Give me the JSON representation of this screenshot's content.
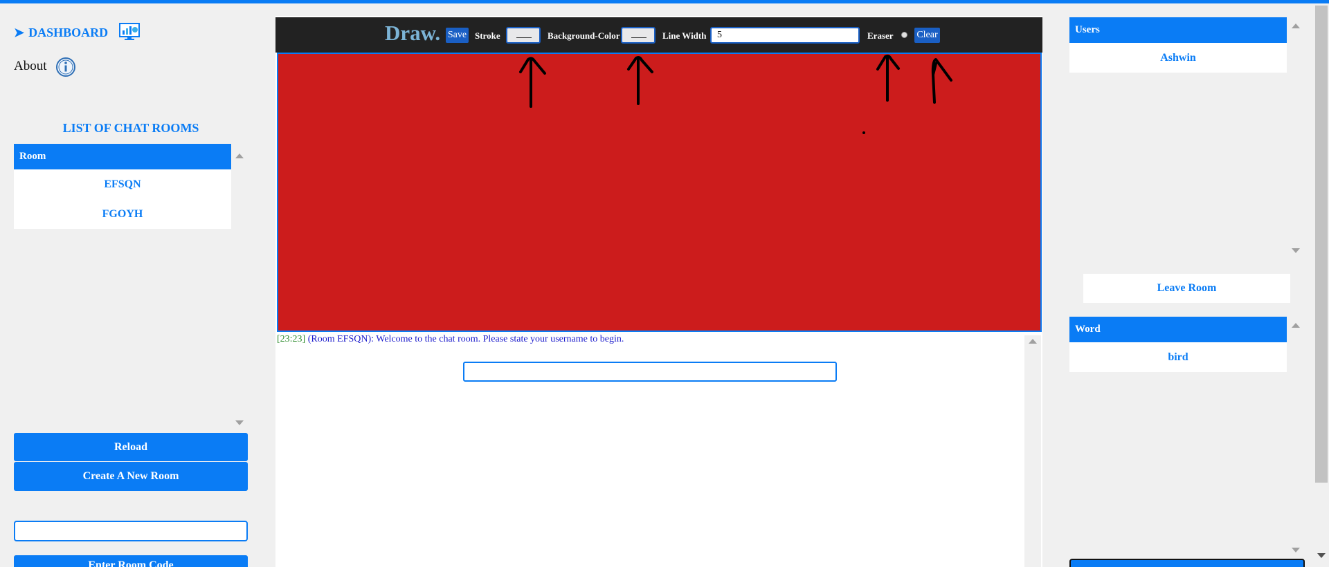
{
  "sidebar": {
    "dashboard_label": "DASHBOARD",
    "about_label": "About",
    "list_title": "LIST OF CHAT ROOMS",
    "rooms_header": "Room",
    "rooms": [
      "EFSQN",
      "FGOYH"
    ],
    "reload_label": "Reload",
    "create_label": "Create A New Room",
    "enter_label": "Enter Room Code"
  },
  "toolbar": {
    "logo": "Draw.",
    "save_label": "Save",
    "stroke_label": "Stroke",
    "background_label": "Background-Color",
    "line_width_label": "Line Width",
    "line_width_value": "5",
    "eraser_label": "Eraser",
    "clear_label": "Clear"
  },
  "canvas": {
    "background_color": "#cc1c1c"
  },
  "chat": {
    "timestamp": "[23:23]",
    "message": "(Room EFSQN): Welcome to the chat room. Please state your username to begin."
  },
  "right": {
    "users_header": "Users",
    "users": [
      "Ashwin"
    ],
    "leave_label": "Leave Room",
    "word_header": "Word",
    "word": "bird"
  },
  "colors": {
    "accent": "#0a7cf5",
    "toolbar_bg": "#222222"
  }
}
